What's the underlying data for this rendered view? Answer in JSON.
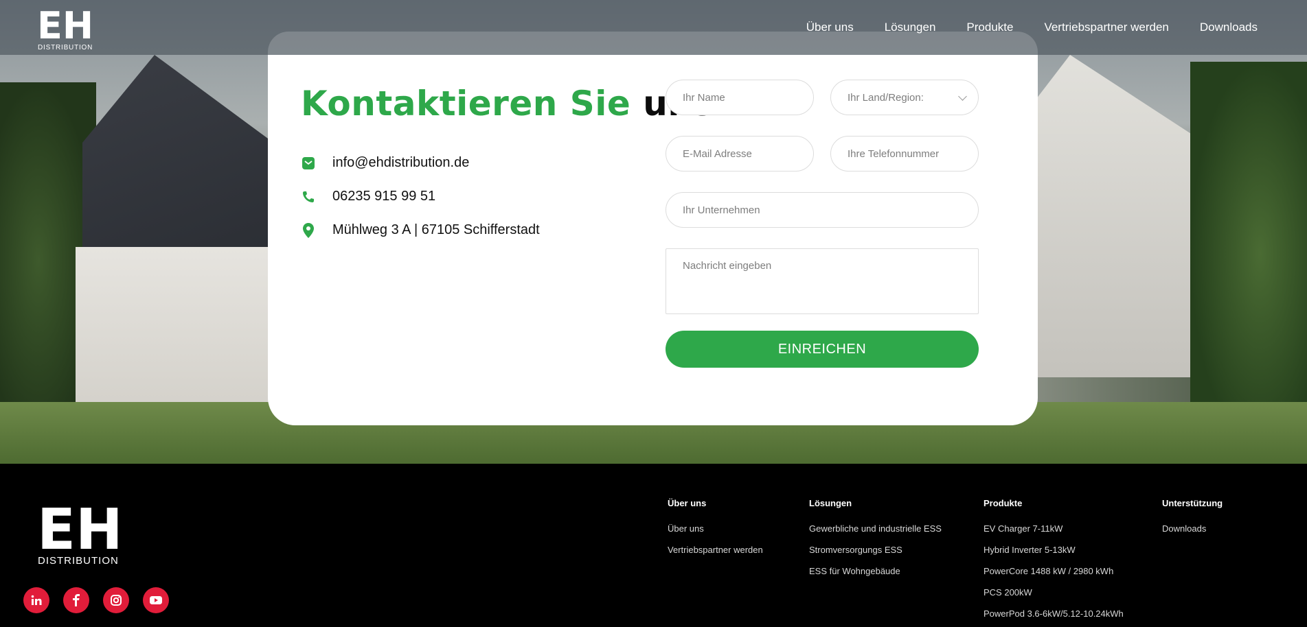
{
  "brand": {
    "logo_text": "EH",
    "logo_subtext": "DISTRIBUTION"
  },
  "nav": [
    {
      "label": "Über uns"
    },
    {
      "label": "Lösungen"
    },
    {
      "label": "Produkte"
    },
    {
      "label": "Vertriebspartner werden"
    },
    {
      "label": "Downloads"
    }
  ],
  "contact": {
    "title_green": "Kontaktieren Sie",
    "title_black": "uns",
    "email": "info@ehdistribution.de",
    "phone": "06235 915 99 51",
    "address": "Mühlweg 3 A | 67105 Schifferstadt"
  },
  "form": {
    "name_placeholder": "Ihr Name",
    "country_placeholder": "Ihr Land/Region:",
    "email_placeholder": "E-Mail Adresse",
    "phone_placeholder": "Ihre Telefonnummer",
    "company_placeholder": "Ihr Unternehmen",
    "message_placeholder": "Nachricht eingeben",
    "submit_label": "EINREICHEN"
  },
  "footer": {
    "columns": [
      {
        "heading": "Über uns",
        "links": [
          "Über uns",
          "Vertriebspartner werden"
        ]
      },
      {
        "heading": "Lösungen",
        "links": [
          "Gewerbliche und industrielle ESS",
          "Stromversorgungs ESS",
          "ESS für Wohngebäude"
        ]
      },
      {
        "heading": "Produkte",
        "links": [
          "EV Charger 7-11kW",
          "Hybrid Inverter 5-13kW",
          "PowerCore 1488 kW / 2980 kWh",
          "PCS 200kW",
          "PowerPod 3.6-6kW/5.12-10.24kWh"
        ]
      },
      {
        "heading": "Unterstützung",
        "links": [
          "Downloads"
        ]
      }
    ],
    "social": [
      "linkedin-icon",
      "facebook-icon",
      "instagram-icon",
      "youtube-icon"
    ]
  },
  "colors": {
    "accent_green": "#2ea84a",
    "social_red": "#e11d3a"
  }
}
